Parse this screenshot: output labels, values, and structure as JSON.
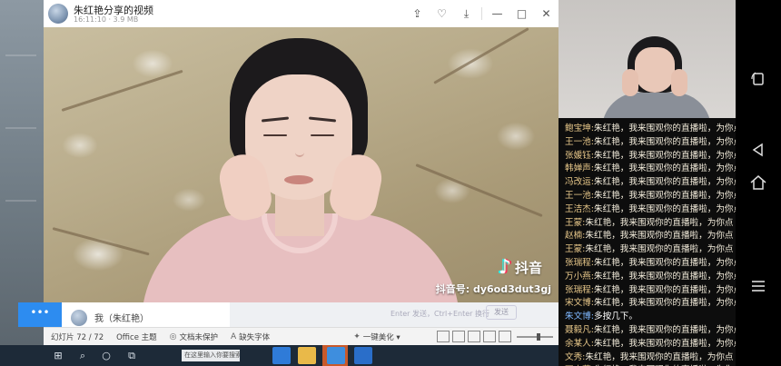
{
  "window": {
    "title": "朱红艳分享的视频",
    "meta": "16:11:10 · 3.9 MB",
    "controls": [
      "⇪",
      "♡",
      "⤓",
      "—",
      "□",
      "✕"
    ]
  },
  "video": {
    "brand_logo": "♪",
    "brand": "抖音",
    "account_id": "抖音号: dy6od3dut3gj"
  },
  "chat_input": {
    "button": "•••",
    "user": "我（朱红艳）",
    "hint": "Enter 发送，Ctrl+Enter 换行",
    "send": "发送"
  },
  "statusbar": {
    "slide": "幻灯片 72 / 72",
    "theme": "Office 主题",
    "protect": "文档未保护",
    "font": "缺失字体",
    "beautify": "一键美化 ▾",
    "protect_icon": "◎",
    "font_icon": "A",
    "beautify_icon": "✦"
  },
  "taskbar": {
    "start_icon": "⊞",
    "search_icon": "⌕",
    "cortana_icon": "○",
    "taskview_icon": "⧉",
    "search_text": "在这里输入你要搜索的内容"
  },
  "chat": [
    {
      "user": "鲍宝坤:",
      "msg": "朱红艳，我来围观你的直播啦，为你点"
    },
    {
      "user": "王一池:",
      "msg": "朱红艳，我来围观你的直播啦，为你点"
    },
    {
      "user": "张媛钰:",
      "msg": "朱红艳，我来围观你的直播啦，为你点"
    },
    {
      "user": "韩婵声:",
      "msg": "朱红艳，我来围观你的直播啦，为你点"
    },
    {
      "user": "冯改运:",
      "msg": "朱红艳，我来围观你的直播啦，为你点"
    },
    {
      "user": "王一池:",
      "msg": "朱红艳，我来围观你的直播啦，为你点"
    },
    {
      "user": "王洁杰:",
      "msg": "朱红艳，我来围观你的直播啦，为你点"
    },
    {
      "user": "王蒙:",
      "msg": "朱红艳，我来围观你的直播啦，为你点"
    },
    {
      "user": "赵楠:",
      "msg": "朱红艳，我来围观你的直播啦，为你点"
    },
    {
      "user": "王蒙:",
      "msg": "朱红艳，我来围观你的直播啦，为你点"
    },
    {
      "user": "张瑞程:",
      "msg": "朱红艳，我来围观你的直播啦，为你点"
    },
    {
      "user": "万小燕:",
      "msg": "朱红艳，我来围观你的直播啦，为你点"
    },
    {
      "user": "张瑞程:",
      "msg": "朱红艳，我来围观你的直播啦，为你点"
    },
    {
      "user": "宋文博:",
      "msg": "朱红艳，我来围观你的直播啦，为你点"
    },
    {
      "user": "朱文博:",
      "msg": "多按几下。",
      "highlight": true
    },
    {
      "user": "聂毅凡:",
      "msg": "朱红艳，我来围观你的直播啦，为你点"
    },
    {
      "user": "余某人:",
      "msg": "朱红艳，我来围观你的直播啦，为你点"
    },
    {
      "user": "文秀:",
      "msg": "朱红艳，我来围观你的直播啦，为你点"
    },
    {
      "user": "万小燕:",
      "msg": "朱红艳，我来围观你的直播啦，为你点"
    }
  ],
  "nav": {
    "rotate_icon": "⟲",
    "back_icon": "◁",
    "home_icon": "⌂",
    "menu_icon": "☰"
  },
  "colors": {
    "chat_user": "#e8c88a",
    "chat_msg": "#f4eddc",
    "chat_highlight_user": "#7fb8ff",
    "accent_blue": "#2d8cf0",
    "taskbar": "#1d2a38"
  }
}
